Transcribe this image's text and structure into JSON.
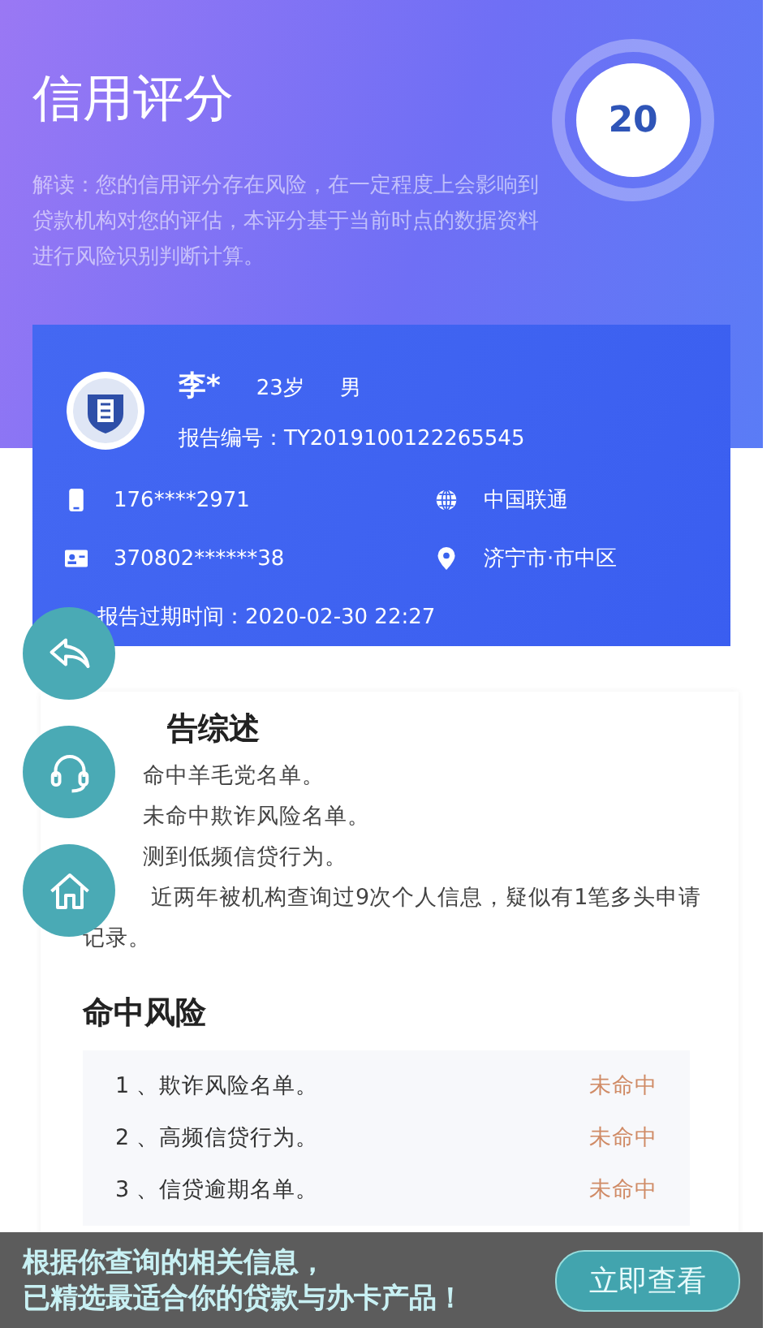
{
  "header": {
    "title": "信用评分",
    "score": "20",
    "description": "解读：您的信用评分存在风险，在一定程度上会影响到贷款机构对您的评估，本评分基于当前时点的数据资料进行风险识别判断计算。"
  },
  "profile": {
    "name": "李*",
    "age": "23岁",
    "gender": "男",
    "report_no": "报告编号：TY2019100122265545",
    "phone": "176****2971",
    "carrier": "中国联通",
    "id_number": "370802******38",
    "location": "济宁市·市中区",
    "expiry": "报告过期时间：2020-02-30 22:27"
  },
  "floating_buttons": [
    {
      "kind": "back"
    },
    {
      "kind": "support"
    },
    {
      "kind": "home"
    }
  ],
  "summary": {
    "title": "告综述",
    "lines": [
      "命中羊毛党名单。",
      "未命中欺诈风险名单。",
      "测到低频信贷行为。",
      "近两年被机构查询过9次个人信息，疑似有1笔多头申请",
      "记录。"
    ]
  },
  "risk": {
    "title": "命中风险",
    "rows": [
      {
        "label": "1 、欺诈风险名单。",
        "status": "未命中"
      },
      {
        "label": "2 、高频信贷行为。",
        "status": "未命中"
      },
      {
        "label": "3 、信贷逾期名单。",
        "status": "未命中"
      }
    ]
  },
  "banner": {
    "line1": "根据你查询的相关信息，",
    "line2": "已精选最适合你的贷款与办卡产品！",
    "button": "立即查看"
  }
}
